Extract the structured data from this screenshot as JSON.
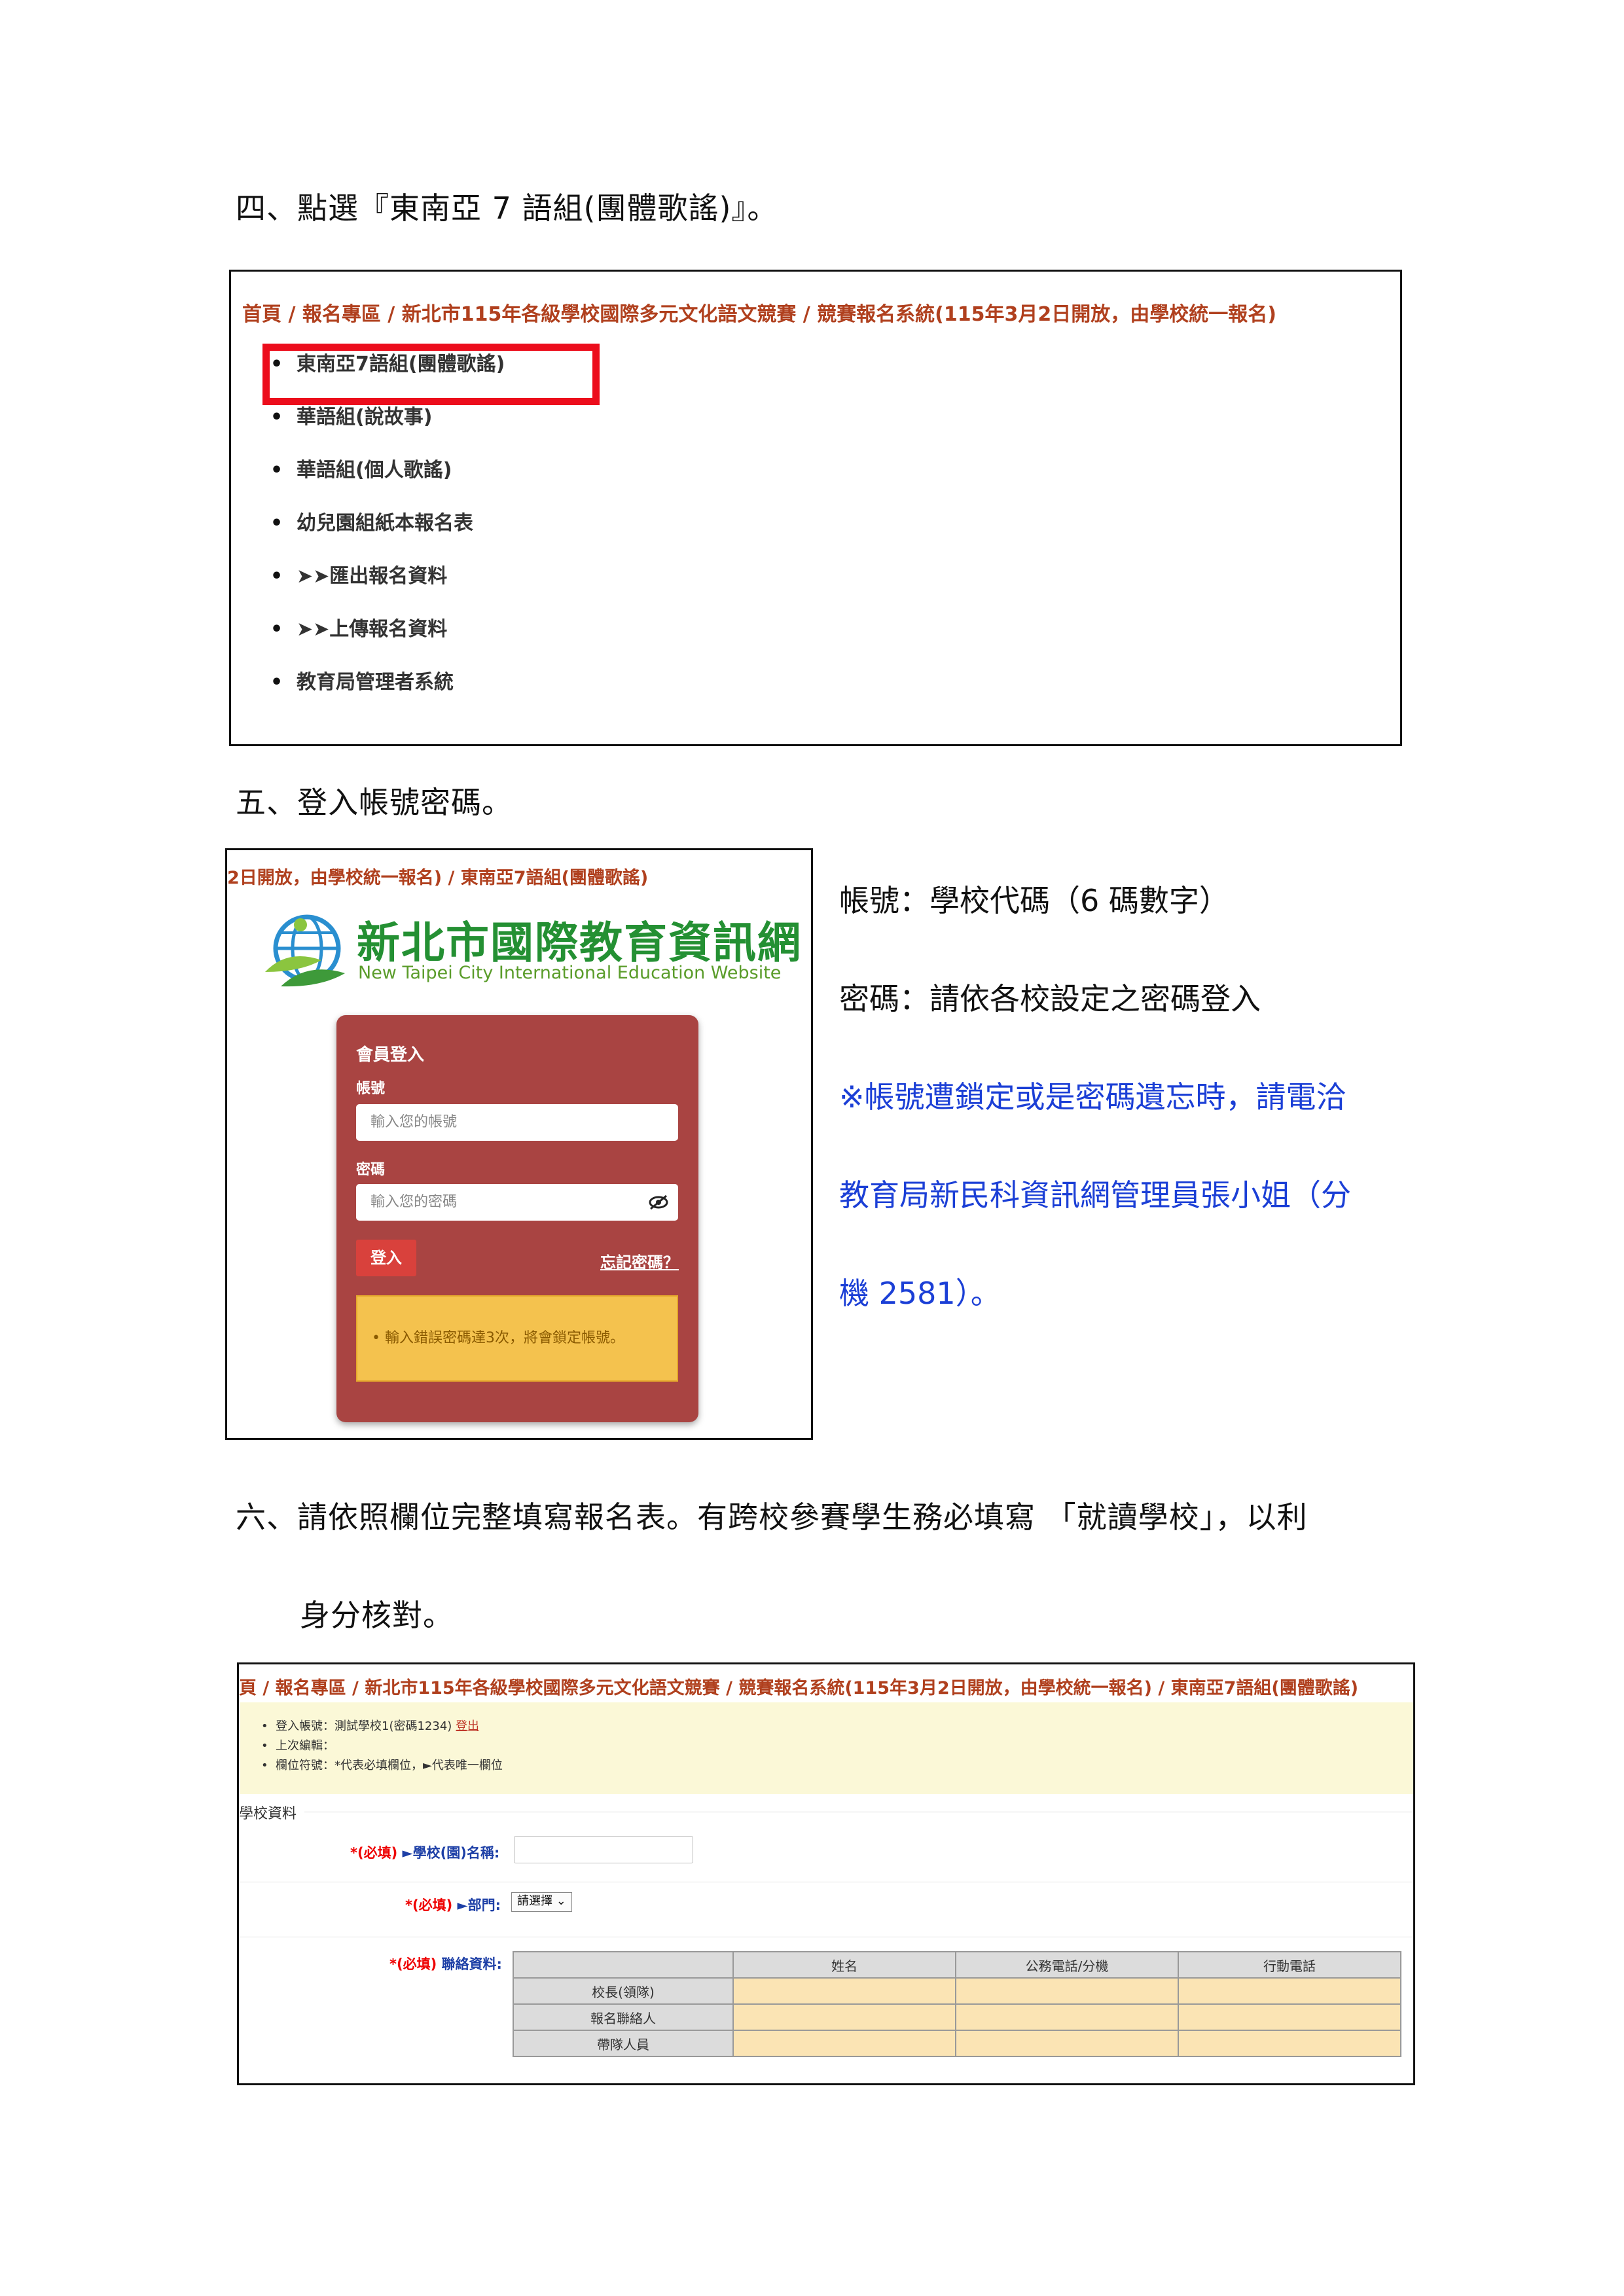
{
  "step4": {
    "text": "四、點選『東南亞 7 語組(團體歌謠)』。"
  },
  "shot1": {
    "breadcrumb": "首頁 / 報名專區 / 新北市115年各級學校國際多元文化語文競賽 / 競賽報名系統(115年3月2日開放，由學校統一報名)",
    "items": [
      "東南亞7語組(團體歌謠)",
      "華語組(說故事)",
      "華語組(個人歌謠)",
      "幼兒園組紙本報名表",
      "➤➤匯出報名資料",
      "➤➤上傳報名資料",
      "教育局管理者系統"
    ],
    "highlight_color": "#ec0d1c"
  },
  "step5": {
    "text": "五、登入帳號密碼。"
  },
  "shot2": {
    "breadcrumb": "2日開放，由學校統一報名) / 東南亞7語組(團體歌謠)",
    "logo_zh": "新北市國際教育資訊網",
    "logo_en": "New Taipei City International Education Website",
    "panel_title": "會員登入",
    "account_label": "帳號",
    "account_placeholder": "輸入您的帳號",
    "password_label": "密碼",
    "password_placeholder": "輸入您的密碼",
    "login_button": "登入",
    "forgot_link": "忘記密碼？",
    "warning": "輸入錯誤密碼達3次，將會鎖定帳號。",
    "panel_color": "#a94442"
  },
  "notes": {
    "account": "帳號：學校代碼（6 碼數字）",
    "password": "密碼：請依各校設定之密碼登入",
    "lock_1": "※帳號遭鎖定或是密碼遺忘時，請電洽",
    "lock_2": "教育局新民科資訊網管理員張小姐（分",
    "lock_3": "機 2581）。"
  },
  "step6": {
    "line1": "六、請依照欄位完整填寫報名表。有跨校參賽學生務必填寫 「就讀學校」，以利",
    "line2": "身分核對。"
  },
  "shot3": {
    "breadcrumb": "頁 / 報名專區 / 新北市115年各級學校國際多元文化語文競賽 / 競賽報名系統(115年3月2日開放，由學校統一報名) / 東南亞7語組(團體歌謠)",
    "info_login": "登入帳號：測試學校1(密碼1234)",
    "info_logout": "登出",
    "info_editor": "上次編輯：",
    "info_symbols": "欄位符號：*代表必填欄位，►代表唯一欄位",
    "section_title": "學校資料",
    "school_req": "*(必填)",
    "school_label": "►學校(園)名稱:",
    "dept_req": "*(必填)",
    "dept_label": "►部門:",
    "dept_value": "請選擇 ⌄",
    "contact_req": "*(必填)",
    "contact_label": "聯絡資料:",
    "table_headers": [
      "姓名",
      "公務電話/分機",
      "行動電話"
    ],
    "table_rows": [
      "校長(領隊)",
      "報名聯絡人",
      "帶隊人員"
    ]
  }
}
